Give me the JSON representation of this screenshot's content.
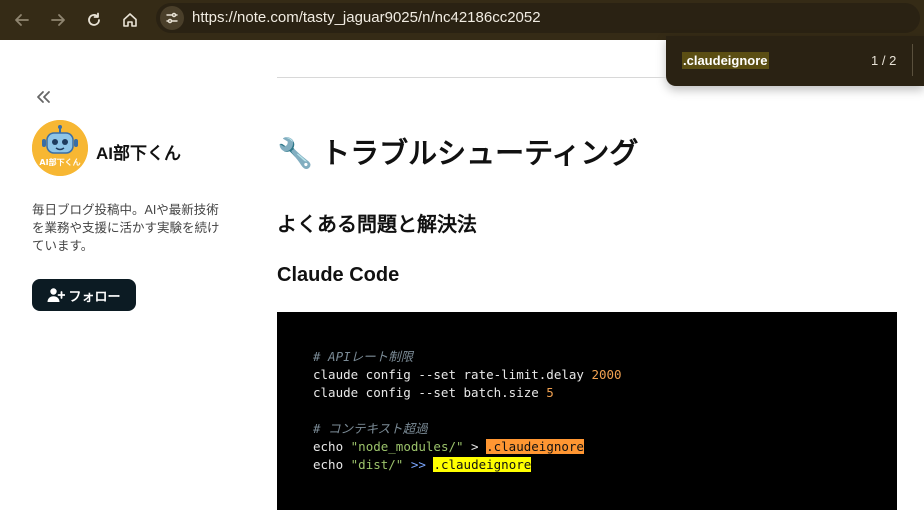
{
  "browser": {
    "url": "https://note.com/tasty_jaguar9025/n/nc42186cc2052",
    "icons": [
      "back-icon",
      "forward-icon",
      "reload-icon",
      "home-icon",
      "site-settings-icon"
    ]
  },
  "find": {
    "term": ".claudeignore",
    "count": "1 / 2"
  },
  "sidebar": {
    "author": "AI部下くん",
    "avatar_text": "AI部下くん",
    "bio": "毎日ブログ投稿中。AIや最新技術を業務や支援に活かす実験を続けています。",
    "follow_label": "フォロー"
  },
  "article": {
    "h1_icon": "🔧",
    "h1": "トラブルシューティング",
    "h2": "よくある問題と解決法",
    "h3": "Claude Code",
    "code": {
      "comment1": "# APIレート制限",
      "line1_cmd": "claude config --set rate-limit.delay ",
      "line1_num": "2000",
      "line2_cmd": "claude config --set batch.size ",
      "line2_num": "5",
      "comment2": "# コンテキスト超過",
      "line3_cmd": "echo ",
      "line3_str": "\"node_modules/\"",
      "line3_op": " > ",
      "line3_target": ".claudeignore",
      "line4_cmd": "echo ",
      "line4_str": "\"dist/\"",
      "line4_op": " >> ",
      "line4_target": ".claudeignore"
    }
  },
  "colors": {
    "toolbar": "#352b16",
    "find_current": "#ff9632",
    "find_match": "#ffff00",
    "follow_button": "#0c1b23"
  }
}
